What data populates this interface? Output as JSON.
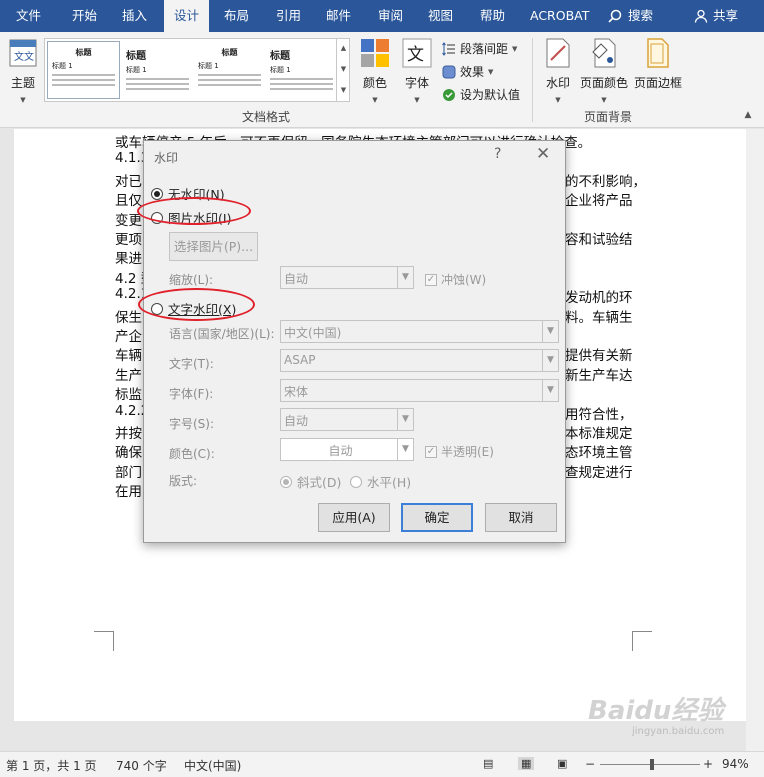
{
  "menu": {
    "items": [
      "文件",
      "开始",
      "插入",
      "设计",
      "布局",
      "引用",
      "邮件",
      "审阅",
      "视图",
      "帮助",
      "ACROBAT"
    ],
    "search_label": "搜索",
    "share_label": "共享"
  },
  "ribbon": {
    "theme_label": "主题",
    "gallery": [
      {
        "title": "标题",
        "heading": "标题 1"
      },
      {
        "title": "标题",
        "heading": "标题 1"
      },
      {
        "title": "标题",
        "heading": "标题 1"
      },
      {
        "title": "标题",
        "heading": "标题 1"
      }
    ],
    "colors_label": "颜色",
    "fonts_label": "字体",
    "paragraph_spacing_label": "段落间距",
    "effects_label": "效果",
    "set_default_label": "设为默认值",
    "doc_format_group": "文档格式",
    "watermark_label": "水印",
    "page_color_label": "页面颜色",
    "page_border_label": "页面边框",
    "page_bg_group": "页面背景"
  },
  "document": {
    "lines": [
      "或车辆停产 5 年后，可不再保留。国务院生态环境主管部门可以进行确认检查。",
      "4.1.3",
      "对已",
      "且仅",
      "变更",
      "更项",
      "果进",
      "4.2 型",
      "4.2.1",
      "保生",
      "产企",
      "车辆",
      "生产",
      "标监",
      "4.2.2",
      "并按",
      "确保",
      "部门",
      "在用"
    ],
    "right_fragments": [
      "的不利影响，",
      "企业将产品",
      "容和试验结",
      "发动机的环",
      "料。车辆生",
      "提供有关新",
      "新生产车达",
      "用符合性，",
      "本标准规定",
      "态环境主管",
      "查规定进行"
    ]
  },
  "dialog": {
    "title": "水印",
    "help": "?",
    "no_watermark": "无水印(N)",
    "picture_watermark": "图片水印(I)",
    "select_picture": "选择图片(P)...",
    "scale_label": "缩放(L):",
    "scale_value": "自动",
    "washout_label": "冲蚀(W)",
    "text_watermark": "文字水印(X)",
    "language_label": "语言(国家/地区)(L):",
    "language_value": "中文(中国)",
    "text_label": "文字(T):",
    "text_value": "ASAP",
    "font_label": "字体(F):",
    "font_value": "宋体",
    "size_label": "字号(S):",
    "size_value": "自动",
    "color_label": "颜色(C):",
    "color_value": "自动",
    "semitransparent_label": "半透明(E)",
    "layout_label": "版式:",
    "diagonal_label": "斜式(D)",
    "horizontal_label": "水平(H)",
    "apply_button": "应用(A)",
    "ok_button": "确定",
    "cancel_button": "取消"
  },
  "status": {
    "page": "第 1 页，共 1 页",
    "words": "740 个字",
    "language": "中文(中国)",
    "zoom": "94%"
  },
  "watermark_overlay": {
    "logo_text": "Baidu经验",
    "url": "jingyan.baidu.com"
  },
  "colors": {
    "accent": "#2b579a",
    "annotation": "#e0202a"
  }
}
